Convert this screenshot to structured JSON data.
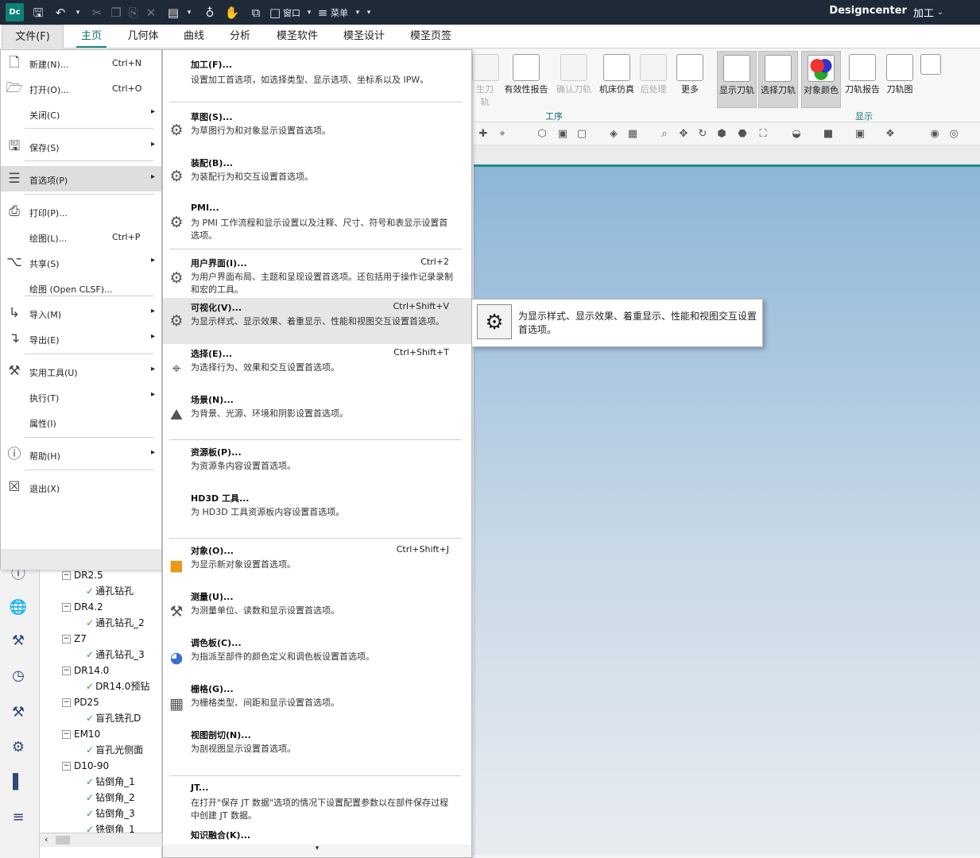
{
  "titlebar": {
    "logo": "Dc",
    "window_menu": "窗口",
    "menu_menu": "菜单",
    "app": "Designcenter",
    "module": "加工"
  },
  "menubar": {
    "tabs": [
      "文件(F)",
      "主页",
      "几何体",
      "曲线",
      "分析",
      "模圣软件",
      "模圣设计",
      "模圣页签"
    ]
  },
  "ribbon": {
    "buttons": [
      {
        "label": "生刀轨",
        "disabled": true
      },
      {
        "label": "有效性报告",
        "disabled": false
      },
      {
        "label": "确认刀轨",
        "disabled": true
      },
      {
        "label": "机床仿真",
        "disabled": false
      },
      {
        "label": "后处理",
        "disabled": true
      },
      {
        "label": "更多",
        "disabled": false
      },
      {
        "label": "显示刀轨",
        "disabled": false
      },
      {
        "label": "选择刀轨",
        "disabled": false
      },
      {
        "label": "对象颜色",
        "disabled": false
      },
      {
        "label": "刀轨报告",
        "disabled": false
      },
      {
        "label": "刀轨图",
        "disabled": false
      }
    ],
    "groups": [
      "工序",
      "显示"
    ]
  },
  "file_menu": {
    "items": [
      {
        "label": "新建(N)...",
        "shortcut": "Ctrl+N",
        "icon": "new-file-icon",
        "arrow": false
      },
      {
        "label": "打开(O)...",
        "shortcut": "Ctrl+O",
        "icon": "open-folder-icon",
        "arrow": false
      },
      {
        "label": "关闭(C)",
        "shortcut": "",
        "icon": "",
        "arrow": true
      },
      {
        "label": "保存(S)",
        "shortcut": "",
        "icon": "save-icon",
        "arrow": true
      },
      {
        "label": "首选项(P)",
        "shortcut": "",
        "icon": "preferences-icon",
        "arrow": true
      },
      {
        "label": "打印(P)...",
        "shortcut": "",
        "icon": "print-icon",
        "arrow": false
      },
      {
        "label": "绘图(L)...",
        "shortcut": "Ctrl+P",
        "icon": "",
        "arrow": false
      },
      {
        "label": "共享(S)",
        "shortcut": "",
        "icon": "share-icon",
        "arrow": true
      },
      {
        "label": "绘图 (Open CLSF)...",
        "shortcut": "",
        "icon": "",
        "arrow": false
      },
      {
        "label": "导入(M)",
        "shortcut": "",
        "icon": "import-icon",
        "arrow": true
      },
      {
        "label": "导出(E)",
        "shortcut": "",
        "icon": "export-icon",
        "arrow": true
      },
      {
        "label": "实用工具(U)",
        "shortcut": "",
        "icon": "utilities-icon",
        "arrow": true
      },
      {
        "label": "执行(T)",
        "shortcut": "",
        "icon": "",
        "arrow": true
      },
      {
        "label": "属性(I)",
        "shortcut": "",
        "icon": "",
        "arrow": false
      },
      {
        "label": "帮助(H)",
        "shortcut": "",
        "icon": "help-icon",
        "arrow": true
      },
      {
        "label": "退出(X)",
        "shortcut": "",
        "icon": "exit-icon",
        "arrow": false
      }
    ]
  },
  "pref_menu": {
    "items": [
      {
        "title": "加工(F)...",
        "desc": "设置加工首选项，如选择类型、显示选项、坐标系以及 IPW。",
        "shortcut": "",
        "icon": ""
      },
      {
        "title": "草图(S)...",
        "desc": "为草图行为和对象显示设置首选项。",
        "shortcut": "",
        "icon": "sketch-gear-icon"
      },
      {
        "title": "装配(B)...",
        "desc": "为装配行为和交互设置首选项。",
        "shortcut": "",
        "icon": "assembly-gear-icon"
      },
      {
        "title": "PMI...",
        "desc": "为 PMI 工作流程和显示设置以及注释、尺寸、符号和表显示设置首选项。",
        "shortcut": "",
        "icon": "pmi-gear-icon"
      },
      {
        "title": "用户界面(I)...",
        "desc": "为用户界面布局、主题和呈现设置首选项。还包括用于操作记录录制和宏的工具。",
        "shortcut": "Ctrl+2",
        "icon": "ui-gear-icon"
      },
      {
        "title": "可视化(V)...",
        "desc": "为显示样式、显示效果、着重显示、性能和视图交互设置首选项。",
        "shortcut": "Ctrl+Shift+V",
        "icon": "visualization-gear-icon"
      },
      {
        "title": "选择(E)...",
        "desc": "为选择行为、效果和交互设置首选项。",
        "shortcut": "Ctrl+Shift+T",
        "icon": "selection-gear-icon"
      },
      {
        "title": "场景(N)...",
        "desc": "为背景、光源、环境和阴影设置首选项。",
        "shortcut": "",
        "icon": "scene-gear-icon"
      },
      {
        "title": "资源板(P)...",
        "desc": "为资源条内容设置首选项。",
        "shortcut": "",
        "icon": ""
      },
      {
        "title": "HD3D 工具...",
        "desc": "为 HD3D 工具资源板内容设置首选项。",
        "shortcut": "",
        "icon": ""
      },
      {
        "title": "对象(O)...",
        "desc": "为显示新对象设置首选项。",
        "shortcut": "Ctrl+Shift+J",
        "icon": "object-gear-icon"
      },
      {
        "title": "测量(U)...",
        "desc": "为测量单位、读数和显示设置首选项。",
        "shortcut": "",
        "icon": "measure-gear-icon"
      },
      {
        "title": "调色板(C)...",
        "desc": "为指派至部件的颜色定义和调色板设置首选项。",
        "shortcut": "",
        "icon": "palette-gear-icon"
      },
      {
        "title": "栅格(G)...",
        "desc": "为栅格类型、间距和显示设置首选项。",
        "shortcut": "",
        "icon": "grid-gear-icon"
      },
      {
        "title": "视图剖切(N)...",
        "desc": "为剖视图显示设置首选项。",
        "shortcut": "",
        "icon": ""
      },
      {
        "title": "JT...",
        "desc": "在打开\"保存 JT 数据\"选项的情况下设置配置参数以在部件保存过程中创建 JT 数据。",
        "shortcut": "",
        "icon": ""
      },
      {
        "title": "知识融合(K)...",
        "desc": "",
        "shortcut": "",
        "icon": ""
      }
    ]
  },
  "tooltip": {
    "text": "为显示样式、显示效果、着重显示、性能和视图交互设置首选项。"
  },
  "nav_tree": {
    "nodes": [
      {
        "label": "DR2.5",
        "level": 0
      },
      {
        "label": "通孔钻孔",
        "level": 1
      },
      {
        "label": "DR4.2",
        "level": 0
      },
      {
        "label": "通孔钻孔_2",
        "level": 1
      },
      {
        "label": "Z7",
        "level": 0
      },
      {
        "label": "通孔钻孔_3",
        "level": 1
      },
      {
        "label": "DR14.0",
        "level": 0
      },
      {
        "label": "DR14.0预钻",
        "level": 1
      },
      {
        "label": "PD25",
        "level": 0
      },
      {
        "label": "盲孔铣孔D",
        "level": 1
      },
      {
        "label": "EM10",
        "level": 0
      },
      {
        "label": "盲孔光侧面",
        "level": 1
      },
      {
        "label": "D10-90",
        "level": 0
      },
      {
        "label": "钻倒角_1",
        "level": 1
      },
      {
        "label": "钻倒角_2",
        "level": 1
      },
      {
        "label": "钻倒角_3",
        "level": 1
      },
      {
        "label": "铣倒角_1",
        "level": 1
      }
    ]
  },
  "colors": {
    "titlebar": "#1e2a38",
    "accent": "#1a8a84",
    "highlight": "#dedede"
  }
}
